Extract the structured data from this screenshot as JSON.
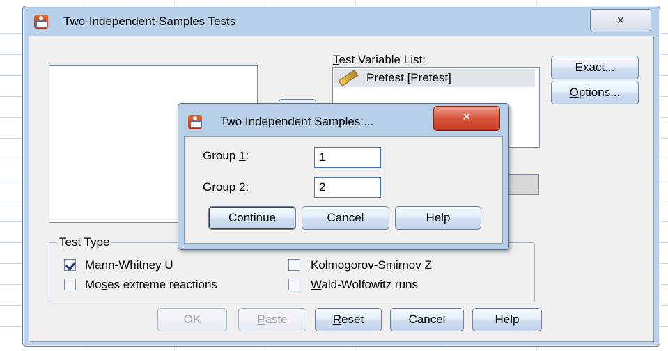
{
  "main_dialog": {
    "title": "Two-Independent-Samples Tests",
    "close_glyph": "✕",
    "test_variable_list": {
      "label_prefix": "",
      "label_underlined": "T",
      "label_suffix": "est Variable List:",
      "items": [
        "Pretest [Pretest]"
      ]
    },
    "side_buttons": {
      "exact": {
        "pre": "E",
        "u": "x",
        "post": "act..."
      },
      "options": {
        "pre": "",
        "u": "O",
        "post": "ptions..."
      }
    },
    "test_type": {
      "label": "Test Type",
      "options": [
        {
          "pre": "",
          "u": "M",
          "post": "ann-Whitney U",
          "checked": true
        },
        {
          "pre": "",
          "u": "K",
          "post": "olmogorov-Smirnov Z",
          "checked": false
        },
        {
          "pre": "Mo",
          "u": "s",
          "post": "es extreme reactions",
          "checked": false
        },
        {
          "pre": "",
          "u": "W",
          "post": "ald-Wolfowitz runs",
          "checked": false
        }
      ]
    },
    "bottom_buttons": {
      "ok": "OK",
      "paste": {
        "pre": "",
        "u": "P",
        "post": "aste"
      },
      "reset": {
        "pre": "",
        "u": "R",
        "post": "eset"
      },
      "cancel": "Cancel",
      "help": "Help"
    }
  },
  "sub_dialog": {
    "title": "Two Independent Samples:...",
    "close_glyph": "✕",
    "group1": {
      "pre": "Group ",
      "u": "1",
      "post": ":",
      "value": "1"
    },
    "group2": {
      "pre": "Group ",
      "u": "2",
      "post": ":",
      "value": "2"
    },
    "buttons": {
      "continue": "Continue",
      "cancel": "Cancel",
      "help": "Help"
    }
  }
}
